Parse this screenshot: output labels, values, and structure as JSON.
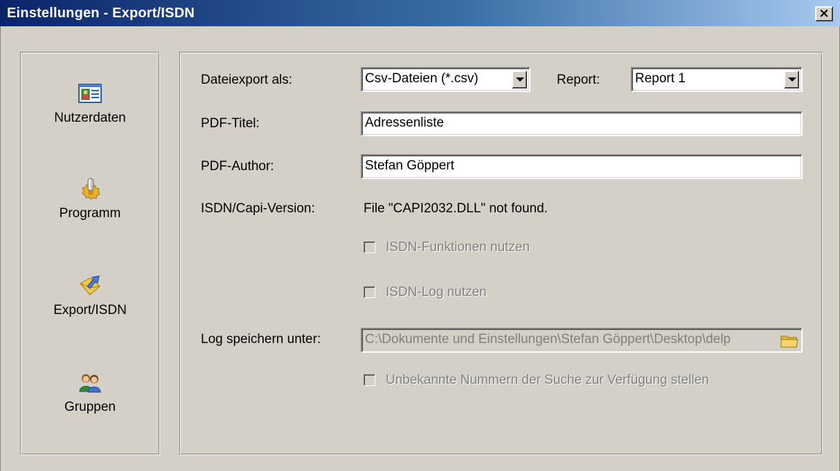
{
  "window": {
    "title": "Einstellungen - Export/ISDN",
    "close_label": "×"
  },
  "nav": {
    "items": [
      {
        "label": "Nutzerdaten",
        "icon": "id-card-icon"
      },
      {
        "label": "Programm",
        "icon": "gear-icon"
      },
      {
        "label": "Export/ISDN",
        "icon": "export-icon"
      },
      {
        "label": "Gruppen",
        "icon": "group-icon"
      }
    ]
  },
  "form": {
    "export_label": "Dateiexport als:",
    "export_value": "Csv-Dateien   (*.csv)",
    "report_label": "Report:",
    "report_value": "Report 1",
    "pdf_title_label": "PDF-Titel:",
    "pdf_title_value": "Adressenliste",
    "pdf_author_label": "PDF-Author:",
    "pdf_author_value": "Stefan Göppert",
    "isdn_version_label": "ISDN/Capi-Version:",
    "isdn_version_value": "File \"CAPI2032.DLL\" not found.",
    "isdn_functions_label": "ISDN-Funktionen nutzen",
    "isdn_log_label": "ISDN-Log nutzen",
    "log_path_label": "Log speichern unter:",
    "log_path_value": "C:\\Dokumente und Einstellungen\\Stefan Göppert\\Desktop\\delp",
    "unknown_numbers_label": "Unbekannte Nummern der Suche zur Verfügung stellen"
  }
}
